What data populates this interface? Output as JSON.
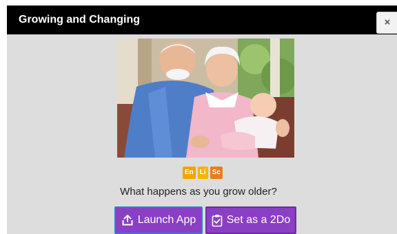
{
  "modal": {
    "title": "Growing and Changing",
    "close_label": "×"
  },
  "badges": [
    {
      "label": "En",
      "color": "#f0a500"
    },
    {
      "label": "Li",
      "color": "#f2b600"
    },
    {
      "label": "Sc",
      "color": "#e87c1e"
    }
  ],
  "question": "What happens as you grow older?",
  "buttons": {
    "launch_label": "Launch App",
    "launch_icon": "upload-icon",
    "set_2do_label": "Set as a 2Do",
    "set_2do_icon": "clipboard-check-icon"
  },
  "colors": {
    "titlebar": "#000000",
    "modal_bg": "#dddddd",
    "button_purple": "#8a3fc4",
    "button_focus_border": "#2a7fd6"
  }
}
